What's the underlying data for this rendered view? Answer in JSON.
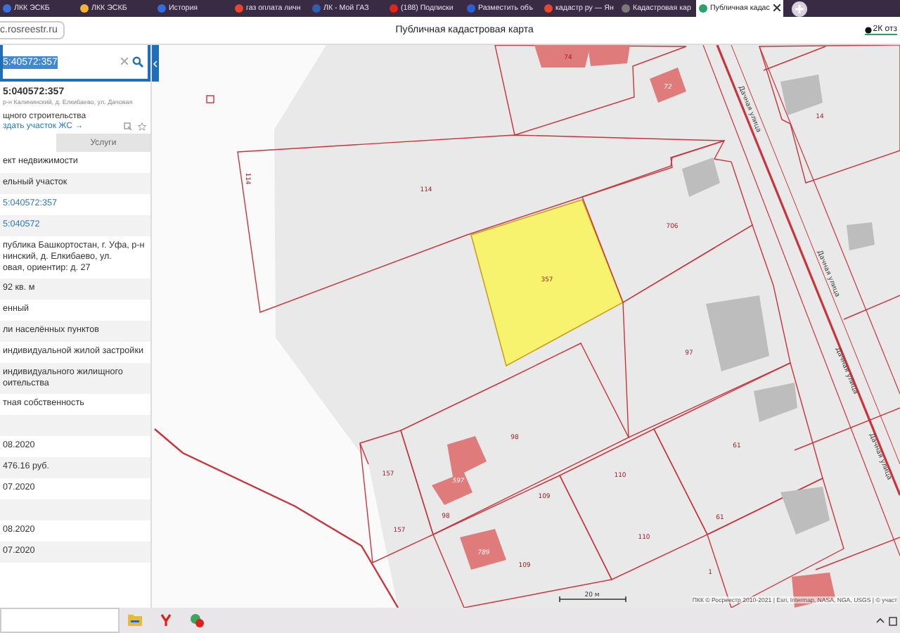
{
  "browser": {
    "tabs": [
      {
        "title": "ЛКК ЭСКБ",
        "selected": false,
        "color": "#3a6fd8"
      },
      {
        "title": "ЛКК ЭСКБ",
        "selected": false,
        "color": "#f2b233"
      },
      {
        "title": "История",
        "selected": false,
        "color": "#2f6de0"
      },
      {
        "title": "газ оплата личн",
        "selected": false,
        "color": "#e8452c"
      },
      {
        "title": "ЛК - Мой ГАЗ",
        "selected": false,
        "color": "#2f5fb0"
      },
      {
        "title": "(188) Подписки",
        "selected": false,
        "color": "#e62117"
      },
      {
        "title": "Разместить объ",
        "selected": false,
        "color": "#2a62d6"
      },
      {
        "title": "кадастр ру — Ян",
        "selected": false,
        "color": "#e8452c"
      },
      {
        "title": "Кадастровая кар",
        "selected": false,
        "color": "#7a7a7a"
      },
      {
        "title": "Публичная кадас",
        "selected": true,
        "color": "#2aa36b"
      }
    ],
    "url": "c.rosreestr.ru",
    "page_title": "Публичная кадастровая карта",
    "reviews": "2К отз"
  },
  "panel": {
    "search": {
      "value": "5:40572:357"
    },
    "title": "5:040572:357",
    "address": "р-н Калининский, д. Елкибаево, ул. Дачовая",
    "info": "щного строительства",
    "link": "здать участок ЖС →",
    "tabs": [
      {
        "label": "Услуги",
        "selected": false
      }
    ],
    "rows": [
      {
        "kind": "text",
        "text": "ект недвижимости"
      },
      {
        "kind": "text",
        "text": "ельный участок"
      },
      {
        "kind": "link",
        "text": "5:040572:357"
      },
      {
        "kind": "link",
        "text": "5:040572"
      },
      {
        "kind": "text",
        "text": "публика Башкортостан, г. Уфа, р-н\nнинский, д. Елкибаево, ул.\nовая, ориентир: д. 27"
      },
      {
        "kind": "text",
        "text": "92 кв. м"
      },
      {
        "kind": "text",
        "text": "енный"
      },
      {
        "kind": "text",
        "text": "ли населённых пунктов"
      },
      {
        "kind": "text",
        "text": " индивидуальной жилой застройки"
      },
      {
        "kind": "text",
        "text": " индивидуального жилищного\nоительства"
      },
      {
        "kind": "text",
        "text": "тная собственность"
      },
      {
        "kind": "blank"
      },
      {
        "kind": "text",
        "text": "08.2020"
      },
      {
        "kind": "text",
        "text": " 476.16 руб."
      },
      {
        "kind": "text",
        "text": "07.2020"
      },
      {
        "kind": "blank"
      },
      {
        "kind": "text",
        "text": "08.2020"
      },
      {
        "kind": "text",
        "text": "07.2020"
      }
    ]
  },
  "map": {
    "parcels": [
      {
        "labels": [
          "114",
          "114"
        ],
        "selected": false
      },
      {
        "labels": [
          "357"
        ],
        "selected": true
      },
      {
        "labels": [
          "74"
        ],
        "selected": false
      },
      {
        "labels": [
          "706"
        ],
        "selected": false
      },
      {
        "labels": [
          "97"
        ],
        "selected": false
      },
      {
        "labels": [
          "98",
          "98"
        ],
        "selected": false
      },
      {
        "labels": [
          "157",
          "157"
        ],
        "selected": false
      },
      {
        "labels": [
          "110",
          "110"
        ],
        "selected": false
      },
      {
        "labels": [
          "61",
          "61"
        ],
        "selected": false
      },
      {
        "labels": [
          "109",
          "109"
        ],
        "selected": false
      },
      {
        "labels": [
          "1"
        ],
        "selected": false
      },
      {
        "labels": [
          "14"
        ],
        "selected": false
      }
    ],
    "buildings": [
      {
        "kind": "residential"
      },
      {
        "kind": "residential"
      },
      {
        "kind": "residential",
        "label": "72"
      },
      {
        "kind": "residential",
        "label": "597"
      },
      {
        "kind": "residential",
        "label": "789"
      },
      {
        "kind": "residential"
      },
      {
        "kind": "other"
      },
      {
        "kind": "other"
      },
      {
        "kind": "other"
      },
      {
        "kind": "other"
      },
      {
        "kind": "other"
      },
      {
        "kind": "other"
      }
    ],
    "streets": [
      "Дачная улица",
      "Дачная улица",
      "Дачная улица",
      "Дачная улица"
    ],
    "scale": "20 м",
    "attribution": "ПКК © Росреестр 2010-2021 | Esri, Intermap, NASA, NGA, USGS | © участ"
  }
}
